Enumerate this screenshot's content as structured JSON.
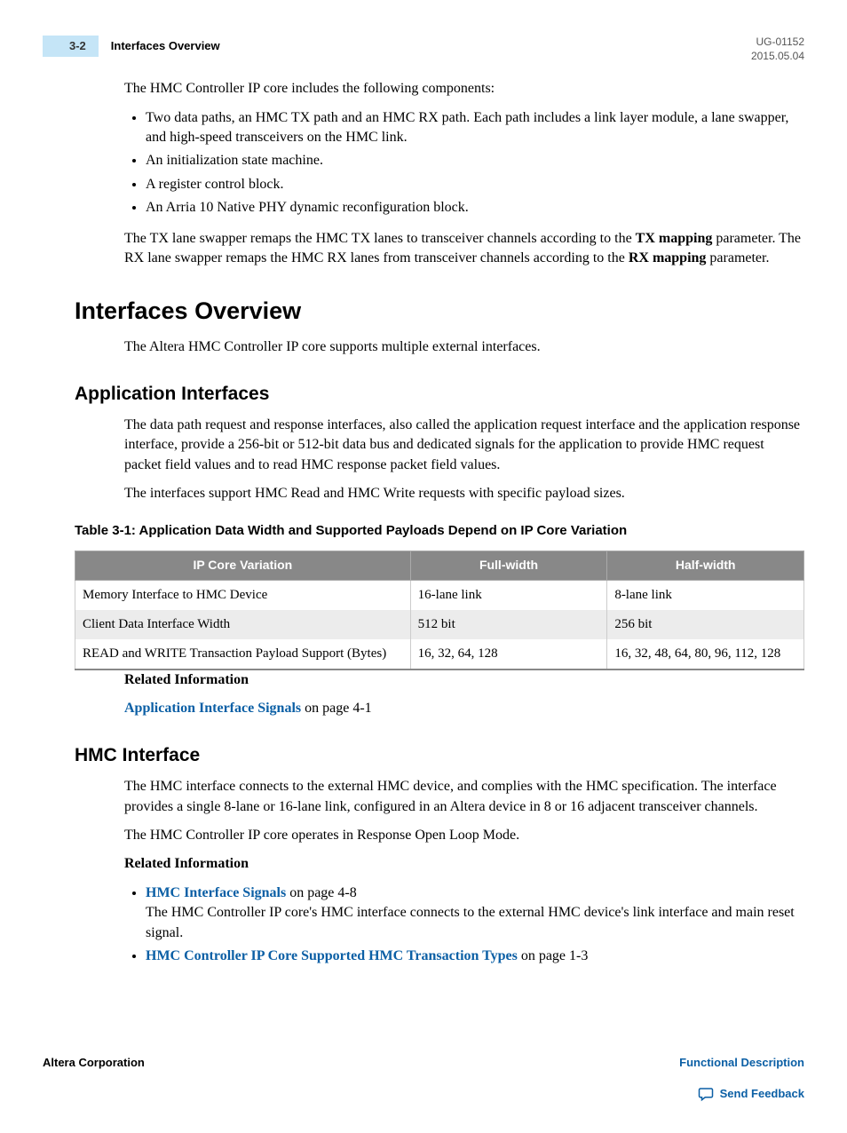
{
  "header": {
    "page_number": "3-2",
    "title": "Interfaces Overview",
    "doc_id": "UG-01152",
    "date": "2015.05.04"
  },
  "intro": {
    "lead": "The HMC Controller IP core includes the following components:",
    "bullets": [
      "Two data paths, an HMC TX path and an HMC RX path. Each path includes a link layer module, a lane swapper, and high-speed transceivers on the HMC link.",
      "An initialization state machine.",
      "A register control block.",
      "An Arria 10 Native PHY dynamic reconfiguration block."
    ],
    "tx_para_1": "The TX lane swapper remaps the HMC TX lanes to transceiver channels according to the ",
    "tx_bold_1": "TX mapping",
    "tx_para_2": " parameter. The RX lane swapper remaps the HMC RX lanes from transceiver channels according to the ",
    "tx_bold_2": "RX mapping",
    "tx_para_3": " parameter."
  },
  "sections": {
    "interfaces_overview": {
      "heading": "Interfaces Overview",
      "p1": "The Altera HMC Controller IP core supports multiple external interfaces."
    },
    "application_interfaces": {
      "heading": "Application Interfaces",
      "p1": "The data path request and response interfaces, also called the application request interface and the application response interface, provide a 256-bit or 512-bit data bus and dedicated signals for the application to provide HMC request packet field values and to read HMC response packet field values.",
      "p2": "The interfaces support HMC Read and HMC Write requests with specific payload sizes.",
      "table_caption": "Table 3-1: Application Data Width and Supported Payloads Depend on IP Core Variation",
      "table": {
        "headers": [
          "IP Core Variation",
          "Full-width",
          "Half-width"
        ],
        "rows": [
          [
            "Memory Interface to HMC Device",
            "16-lane link",
            "8-lane link"
          ],
          [
            "Client Data Interface Width",
            "512 bit",
            "256 bit"
          ],
          [
            "READ and WRITE Transaction Payload Support (Bytes)",
            "16, 32, 64, 128",
            "16, 32, 48, 64, 80, 96, 112, 128"
          ]
        ]
      },
      "related_label": "Related Information",
      "related_link": "Application Interface Signals",
      "related_suffix": " on page 4-1"
    },
    "hmc_interface": {
      "heading": "HMC Interface",
      "p1": "The HMC interface connects to the external HMC device, and complies with the HMC specification. The interface provides a single 8-lane or 16-lane link, configured in an Altera device in 8 or 16 adjacent transceiver channels.",
      "p2": "The HMC Controller IP core operates in Response Open Loop Mode.",
      "related_label": "Related Information",
      "related": [
        {
          "link": "HMC Interface Signals",
          "suffix": " on page 4-8",
          "desc": "The HMC Controller IP core's HMC interface connects to the external HMC device's link interface and main reset signal."
        },
        {
          "link": "HMC Controller IP Core Supported HMC Transaction Types",
          "suffix": " on page 1-3",
          "desc": ""
        }
      ]
    }
  },
  "footer": {
    "left": "Altera Corporation",
    "right_top": "Functional Description",
    "right_bottom": "Send Feedback"
  }
}
